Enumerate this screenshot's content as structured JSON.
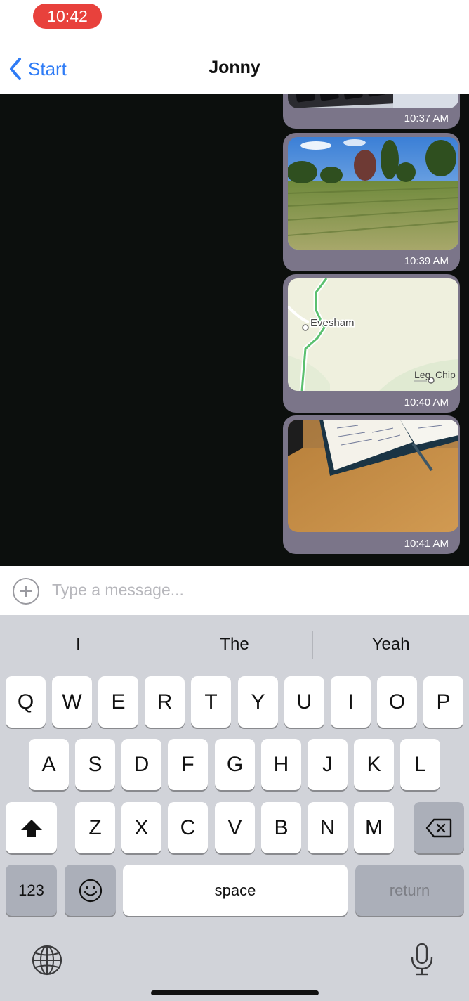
{
  "status_bar": {
    "time": "10:42",
    "time_pill_color": "#e8413c"
  },
  "nav": {
    "back_label": "Start",
    "title": "Jonny",
    "accent_color": "#2f7cf6"
  },
  "messages": [
    {
      "type": "photo",
      "content": "keyboard photo",
      "time": "10:37 AM"
    },
    {
      "type": "photo",
      "content": "park field photo",
      "time": "10:39 AM"
    },
    {
      "type": "map",
      "map_labels": [
        "Evesham",
        "Leg",
        "Chip"
      ],
      "time": "10:40 AM"
    },
    {
      "type": "photo",
      "content": "notebook on desk photo",
      "time": "10:41 AM"
    }
  ],
  "composer": {
    "placeholder": "Type a message..."
  },
  "keyboard": {
    "suggestions": [
      "I",
      "The",
      "Yeah"
    ],
    "rows": [
      [
        "Q",
        "W",
        "E",
        "R",
        "T",
        "Y",
        "U",
        "I",
        "O",
        "P"
      ],
      [
        "A",
        "S",
        "D",
        "F",
        "G",
        "H",
        "J",
        "K",
        "L"
      ],
      [
        "Z",
        "X",
        "C",
        "V",
        "B",
        "N",
        "M"
      ]
    ],
    "numbers_label": "123",
    "space_label": "space",
    "return_label": "return",
    "icons": [
      "shift-icon",
      "backspace-icon",
      "emoji-icon",
      "globe-icon",
      "microphone-icon"
    ]
  }
}
